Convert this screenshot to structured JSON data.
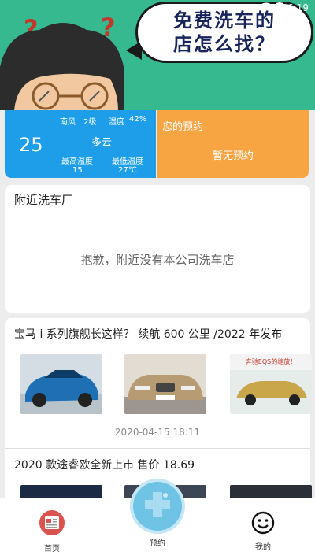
{
  "status_bar": {
    "time": "6:19"
  },
  "banner": {
    "line1": "免费洗车的",
    "line2": "店怎么找？"
  },
  "weather": {
    "temperature": "25",
    "wind": "南风",
    "wind_level": "2级",
    "humidity_label": "湿度",
    "humidity": "42%",
    "condition": "多云",
    "max_label": "最高温度",
    "max_value": "15",
    "min_label": "最低温度",
    "min_value": "27℃"
  },
  "reservation": {
    "title": "您的预约",
    "empty": "暂无预约"
  },
  "nearby": {
    "title": "附近洗车厂",
    "empty": "抱歉，附近没有本公司洗车店"
  },
  "news": [
    {
      "title": "宝马 i 系列旗舰长这样？ 续航 600 公里 /2022 年发布",
      "date": "2020-04-15 18:11",
      "thumb_caption": "奔驰EQS的缩放！"
    },
    {
      "title": "2020 款途睿欧全新上市 售价 18.69"
    }
  ],
  "bottom_nav": {
    "home": "首页",
    "reserve": "预约",
    "mine": "我的"
  },
  "colors": {
    "banner": "#36b98f",
    "weather": "#1e9ee8",
    "reservation": "#f7a443",
    "center_button": "#6fc3e5"
  }
}
